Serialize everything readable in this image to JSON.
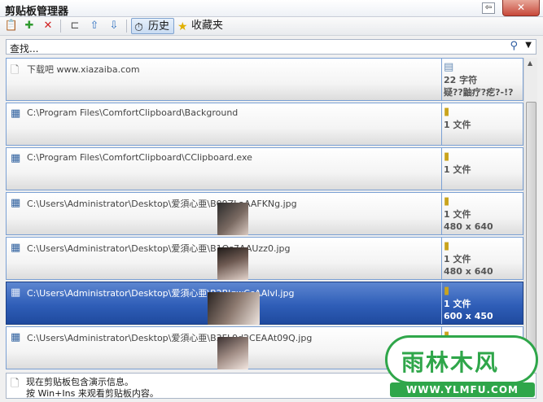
{
  "window": {
    "title": "剪贴板管理器",
    "pin_glyph": "⇦",
    "close_glyph": "✕"
  },
  "toolbar": {
    "tab_history": "历史",
    "tab_favorites": "收藏夹",
    "icons": [
      "clipboard-paste-icon",
      "add-favorite-icon",
      "delete-icon",
      "hierarchy-icon",
      "move-up-icon",
      "move-down-icon",
      "history-icon",
      "star-icon"
    ]
  },
  "search": {
    "placeholder": "查找..."
  },
  "list": {
    "items": [
      {
        "path": "下载吧 www.xiazaiba.com",
        "meta1": "22 字符",
        "meta2": "疑??鼬疗?疙?-!?"
      },
      {
        "path": "C:\\Program Files\\ComfortClipboard\\Background",
        "meta1": "1 文件",
        "meta2": ""
      },
      {
        "path": "C:\\Program Files\\ComfortClipboard\\CClipboard.exe",
        "meta1": "1 文件",
        "meta2": ""
      },
      {
        "path": "C:\\Users\\Administrator\\Desktop\\爱須心亜\\B09ZLaAAFKNg.jpg",
        "meta1": "1 文件",
        "meta2": "480 x 640"
      },
      {
        "path": "C:\\Users\\Administrator\\Desktop\\爱須心亜\\B1Qs7AAUzz0.jpg",
        "meta1": "1 文件",
        "meta2": "480 x 640"
      },
      {
        "path": "C:\\Users\\Administrator\\Desktop\\爱須心亜\\B2BlqwCcAAlvl.jpg",
        "meta1": "1 文件",
        "meta2": "600 x 450"
      },
      {
        "path": "C:\\Users\\Administrator\\Desktop\\爱須心亜\\B3FL9d2CEAAt09Q.jpg",
        "meta1": "",
        "meta2": ""
      }
    ],
    "selected_index": 5
  },
  "status": {
    "line1": "现在剪贴板包含演示信息。",
    "line2": "按 Win+Ins 来观看剪贴板内容。"
  },
  "watermark": {
    "brand": "雨林木风",
    "url": "WWW.YLMFU.COM"
  },
  "colors": {
    "selection": "#2f5eb8",
    "row_border": "#7aa0d4",
    "watermark": "#2fa64a"
  }
}
